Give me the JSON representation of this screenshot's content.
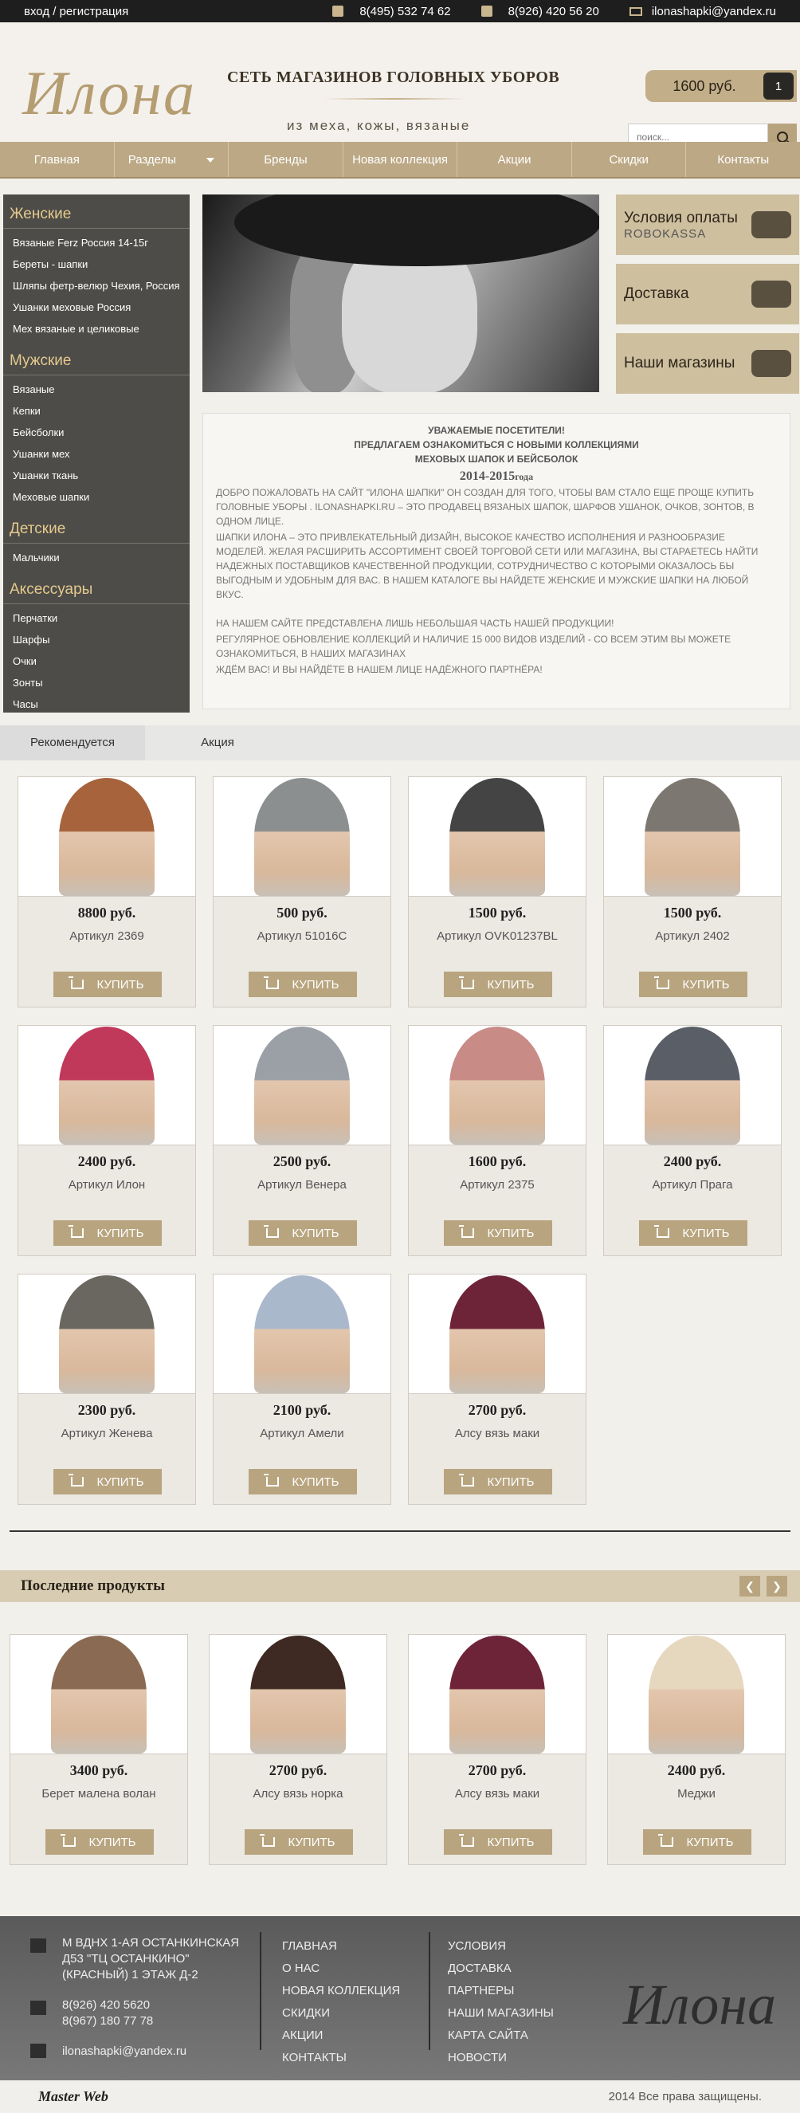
{
  "topbar": {
    "login": "вход / регистрация",
    "phone1": "8(495) 532 74 62",
    "phone2": "8(926) 420 56 20",
    "email": "ilonashapki@yandex.ru"
  },
  "header": {
    "logo_text": "Илона",
    "tagline": "СЕТЬ МАГАЗИНОВ ГОЛОВНЫХ УБОРОВ",
    "subtagline": "из меха, кожы, вязаные",
    "cart_sum": "1600 руб.",
    "cart_count": "1",
    "search_placeholder": "поиск..."
  },
  "nav": [
    "Главная",
    "Разделы",
    "Бренды",
    "Новая коллекция",
    "Акции",
    "Скидки",
    "Контакты"
  ],
  "sidebar": [
    {
      "title": "Женские",
      "items": [
        "Вязаные Ferz Россия 14-15г",
        "Береты - шапки",
        "Шляпы фетр-велюр Чехия, Россия",
        "Ушанки меховые Россия",
        "Мех вязаные и целиковые"
      ]
    },
    {
      "title": "Мужские",
      "items": [
        "Вязаные",
        "Кепки",
        "Бейсболки",
        "Ушанки мех",
        "Ушанки ткань",
        "Меховые шапки"
      ]
    },
    {
      "title": "Детские",
      "items": [
        "Мальчики"
      ]
    },
    {
      "title": "Аксессуары",
      "items": [
        "Перчатки",
        "Шарфы",
        "Очки",
        "Зонты",
        "Часы"
      ]
    }
  ],
  "promos": [
    {
      "title": "Условия оплаты",
      "sub": "ROBOKASSA"
    },
    {
      "title": "Доставка",
      "sub": ""
    },
    {
      "title": "Наши магазины",
      "sub": ""
    }
  ],
  "welcome": {
    "h1": "УВАЖАЕМЫЕ ПОСЕТИТЕЛИ!",
    "h2": "ПРЕДЛАГАЕМ ОЗНАКОМИТЬСЯ С НОВЫМИ КОЛЛЕКЦИЯМИ",
    "h3": "МЕХОВЫХ ШАПОК И БЕЙСБОЛОК",
    "year": "2014-2015",
    "year_suffix": "года",
    "p1": "ДОБРО ПОЖАЛОВАТЬ НА САЙТ \"ИЛОНА ШАПКИ\" ОН СОЗДАН ДЛЯ ТОГО, ЧТОБЫ ВАМ СТАЛО ЕЩЕ ПРОЩЕ КУПИТЬ ГОЛОВНЫЕ УБОРЫ . ILONASHAPKI.RU – ЭТО  ПРОДАВЕЦ ВЯЗАНЫХ ШАПОК, ШАРФОВ УШАНОК, ОЧКОВ, ЗОНТОВ, В ОДНОМ ЛИЦЕ.",
    "p2": "ШАПКИ ИЛОНА – ЭТО ПРИВЛЕКАТЕЛЬНЫЙ ДИЗАЙН, ВЫСОКОЕ КАЧЕСТВО ИСПОЛНЕНИЯ И РАЗНООБРАЗИЕ МОДЕЛЕЙ. ЖЕЛАЯ РАСШИРИТЬ АССОРТИМЕНТ СВОЕЙ ТОРГОВОЙ СЕТИ ИЛИ МАГАЗИНА, ВЫ СТАРАЕТЕСЬ НАЙТИ НАДЕЖНЫХ ПОСТАВЩИКОВ КАЧЕСТВЕННОЙ ПРОДУКЦИИ, СОТРУДНИЧЕСТВО С КОТОРЫМИ ОКАЗАЛОСЬ БЫ ВЫГОДНЫМ И УДОБНЫМ ДЛЯ ВАС. В НАШЕМ КАТАЛОГЕ ВЫ НАЙДЕТЕ ЖЕНСКИЕ И МУЖСКИЕ  ШАПКИ НА ЛЮБОЙ ВКУС.",
    "p3": "НА НАШЕМ САЙТЕ  ПРЕДСТАВЛЕНА ЛИШЬ НЕБОЛЬШАЯ ЧАСТЬ НАШЕЙ ПРОДУКЦИИ!",
    "p4": "РЕГУЛЯРНОЕ ОБНОВЛЕНИЕ КОЛЛЕКЦИЙ И НАЛИЧИЕ 15 000 ВИДОВ ИЗДЕЛИЙ - СО ВСЕМ ЭТИМ ВЫ МОЖЕТЕ ОЗНАКОМИТЬСЯ, В НАШИХ МАГАЗИНАХ",
    "p5": "ЖДЁМ ВАС! И ВЫ НАЙДЁТЕ В НАШЕМ ЛИЦЕ НАДЁЖНОГО ПАРТНЁРА!"
  },
  "tabs": [
    "Рекомендуется",
    "Акция"
  ],
  "buy_label": "КУПИТЬ",
  "recommended": [
    {
      "price": "8800 руб.",
      "name": "Артикул 2369",
      "color": "#a7633c"
    },
    {
      "price": "500 руб.",
      "name": "Артикул 51016С",
      "color": "#8b8f90"
    },
    {
      "price": "1500 руб.",
      "name": "Артикул OVK01237BL",
      "color": "#444444"
    },
    {
      "price": "1500 руб.",
      "name": "Артикул 2402",
      "color": "#7c7770"
    },
    {
      "price": "2400 руб.",
      "name": "Артикул Илон",
      "color": "#c0395a"
    },
    {
      "price": "2500 руб.",
      "name": "Артикул Венера",
      "color": "#9aa0a6"
    },
    {
      "price": "1600 руб.",
      "name": "Артикул 2375",
      "color": "#c88b86"
    },
    {
      "price": "2400 руб.",
      "name": "Артикул Прага",
      "color": "#5a5e66"
    },
    {
      "price": "2300 руб.",
      "name": "Артикул Женева",
      "color": "#6a6660"
    },
    {
      "price": "2100 руб.",
      "name": "Артикул Амели",
      "color": "#aab8cc"
    },
    {
      "price": "2700 руб.",
      "name": "Алсу вязь маки",
      "color": "#6e2438"
    }
  ],
  "latest_title": "Последние продукты",
  "latest": [
    {
      "price": "3400 руб.",
      "name": "Берет малена волан",
      "color": "#8a6a52"
    },
    {
      "price": "2700 руб.",
      "name": "Алсу вязь норка",
      "color": "#3e2a22"
    },
    {
      "price": "2700 руб.",
      "name": "Алсу вязь маки",
      "color": "#6e2438"
    },
    {
      "price": "2400 руб.",
      "name": "Меджи",
      "color": "#e6d7bf"
    }
  ],
  "footer": {
    "address": [
      "М ВДНХ 1-АЯ ОСТАНКИНСКАЯ",
      "Д53 \"ТЦ ОСТАНКИНО\"",
      "(КРАСНЫЙ) 1 ЭТАЖ Д-2"
    ],
    "phones": [
      "8(926) 420 5620",
      "8(967) 180 77 78"
    ],
    "email": "ilonashapki@yandex.ru",
    "col2": [
      "ГЛАВНАЯ",
      "О НАС",
      "НОВАЯ КОЛЛЕКЦИЯ",
      "СКИДКИ",
      "АКЦИИ",
      "КОНТАКТЫ"
    ],
    "col3": [
      "УСЛОВИЯ",
      "ДОСТАВКА",
      "ПАРТНЕРЫ",
      "НАШИ МАГАЗИНЫ",
      "КАРТА САЙТА",
      "НОВОСТИ"
    ],
    "logo_text": "Илона",
    "maker": "Master Web",
    "copyright": "2014 Все права защищены."
  }
}
